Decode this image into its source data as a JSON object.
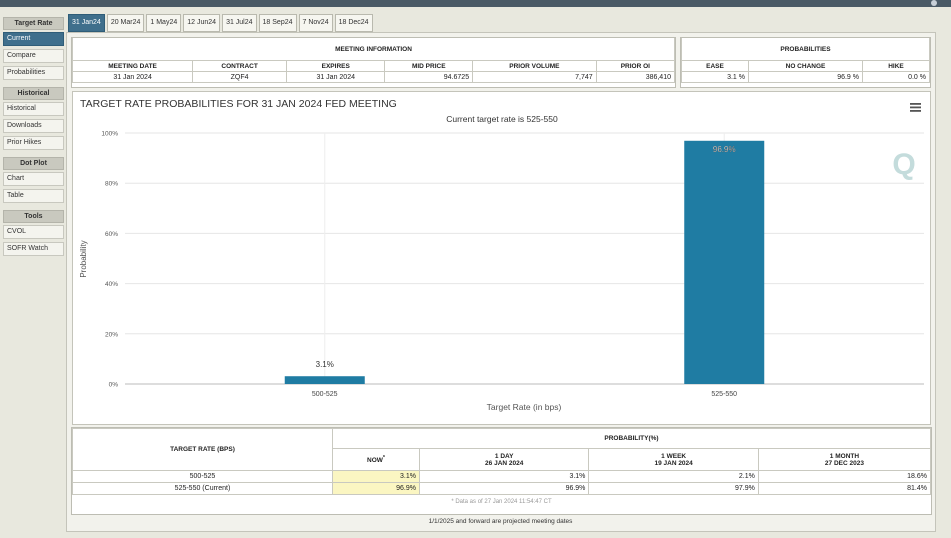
{
  "sidebar": {
    "sections": [
      {
        "title": "Target Rate",
        "items": [
          {
            "label": "Current",
            "active": true
          },
          {
            "label": "Compare"
          },
          {
            "label": "Probabilities"
          }
        ]
      },
      {
        "title": "Historical",
        "items": [
          {
            "label": "Historical"
          },
          {
            "label": "Downloads"
          },
          {
            "label": "Prior Hikes"
          }
        ]
      },
      {
        "title": "Dot Plot",
        "items": [
          {
            "label": "Chart"
          },
          {
            "label": "Table"
          }
        ]
      },
      {
        "title": "Tools",
        "items": [
          {
            "label": "CVOL"
          },
          {
            "label": "SOFR Watch"
          }
        ]
      }
    ]
  },
  "tabs": [
    "31 Jan24",
    "20 Mar24",
    "1 May24",
    "12 Jun24",
    "31 Jul24",
    "18 Sep24",
    "7 Nov24",
    "18 Dec24"
  ],
  "meeting_info": {
    "title": "MEETING INFORMATION",
    "headers": [
      "MEETING DATE",
      "CONTRACT",
      "EXPIRES",
      "MID PRICE",
      "PRIOR VOLUME",
      "PRIOR OI"
    ],
    "values": [
      "31 Jan 2024",
      "ZQF4",
      "31 Jan 2024",
      "94.6725",
      "7,747",
      "386,410"
    ]
  },
  "probabilities": {
    "title": "PROBABILITIES",
    "headers": [
      "EASE",
      "NO CHANGE",
      "HIKE"
    ],
    "values": [
      "3.1 %",
      "96.9 %",
      "0.0 %"
    ]
  },
  "chart_data": {
    "type": "bar",
    "title": "TARGET RATE PROBABILITIES FOR 31 JAN 2024 FED MEETING",
    "subtitle": "Current target rate is 525-550",
    "categories": [
      "500-525",
      "525-550"
    ],
    "values": [
      3.1,
      96.9
    ],
    "value_labels": [
      "3.1%",
      "96.9%"
    ],
    "xlabel": "Target Rate (in bps)",
    "ylabel": "Probability",
    "ylim": [
      0,
      100
    ],
    "yticks": [
      "0%",
      "20%",
      "40%",
      "60%",
      "80%",
      "100%"
    ],
    "bar_color": "#1f7ca3",
    "grid": true,
    "watermark": "Q"
  },
  "bottom_table": {
    "target_rate_header": "TARGET RATE (BPS)",
    "prob_header": "PROBABILITY(%)",
    "columns": [
      {
        "label": "NOW",
        "date": ""
      },
      {
        "label": "1 DAY",
        "date": "26 JAN 2024"
      },
      {
        "label": "1 WEEK",
        "date": "19 JAN 2024"
      },
      {
        "label": "1 MONTH",
        "date": "27 DEC 2023"
      }
    ],
    "rows": [
      {
        "rate": "500-525",
        "values": [
          "3.1%",
          "3.1%",
          "2.1%",
          "18.6%"
        ]
      },
      {
        "rate": "525-550 (Current)",
        "values": [
          "96.9%",
          "96.9%",
          "97.9%",
          "81.4%"
        ]
      }
    ],
    "note": "* Data as of 27 Jan 2024 11:54:47 CT",
    "footer": "1/1/2025 and forward are projected meeting dates"
  }
}
